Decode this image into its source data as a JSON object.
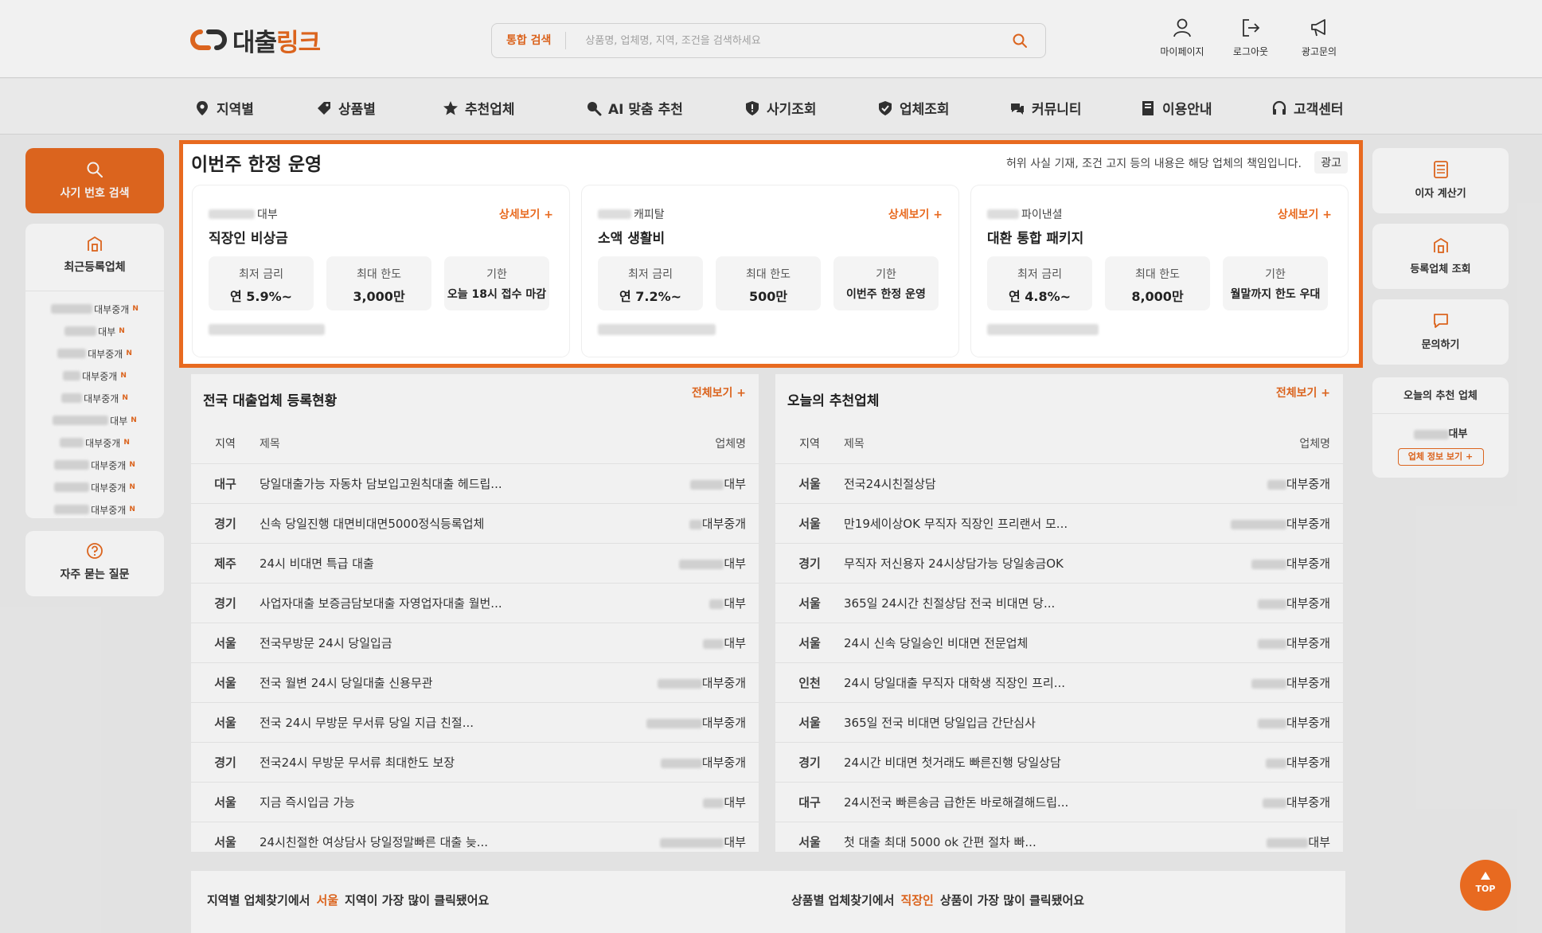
{
  "header": {
    "logo_text_a": "대출",
    "logo_text_b": "링크",
    "search_label": "통합 검색",
    "search_placeholder": "상품명, 업체명, 지역, 조건을 검색하세요",
    "icons": [
      {
        "label": "마이페이지",
        "icon": "user-icon"
      },
      {
        "label": "로그아웃",
        "icon": "logout-icon"
      },
      {
        "label": "광고문의",
        "icon": "megaphone-icon"
      }
    ]
  },
  "nav": [
    {
      "label": "지역별",
      "icon": "map-pin-icon"
    },
    {
      "label": "상품별",
      "icon": "tag-icon"
    },
    {
      "label": "추천업체",
      "icon": "star-icon"
    },
    {
      "label": "AI 맞춤 추천",
      "icon": "search-ai-icon"
    },
    {
      "label": "사기조회",
      "icon": "shield-alert-icon"
    },
    {
      "label": "업체조회",
      "icon": "shield-check-icon"
    },
    {
      "label": "커뮤니티",
      "icon": "chat-icon"
    },
    {
      "label": "이용안내",
      "icon": "book-icon"
    },
    {
      "label": "고객센터",
      "icon": "headset-icon"
    }
  ],
  "left_sidebar": {
    "fraud_search": "사기 번호 검색",
    "recent_title": "최근등록업체",
    "recent_items": [
      {
        "suffix": "대부중개",
        "new": "N"
      },
      {
        "suffix": "대부",
        "new": "N"
      },
      {
        "suffix": "대부중개",
        "new": "N"
      },
      {
        "suffix": "대부중개",
        "new": "N"
      },
      {
        "suffix": "대부중개",
        "new": "N"
      },
      {
        "suffix": "대부",
        "new": "N"
      },
      {
        "suffix": "대부중개",
        "new": "N"
      },
      {
        "suffix": "대부중개",
        "new": "N"
      },
      {
        "suffix": "대부중개",
        "new": "N"
      },
      {
        "suffix": "대부중개",
        "new": "N"
      }
    ],
    "faq": "자주 묻는 질문"
  },
  "featured": {
    "title": "이번주 한정 운영",
    "notice": "허위 사실 기재, 조건 고지 등의 내용은 해당 업체의 책임입니다.",
    "ad_label": "광고",
    "more_label": "상세보기 +",
    "cards": [
      {
        "company_suffix": "대부",
        "product": "직장인 비상금",
        "stats": [
          {
            "label": "최저 금리",
            "value": "연 5.9%~"
          },
          {
            "label": "최대 한도",
            "value": "3,000만"
          },
          {
            "label": "기한",
            "value": "오늘 18시 접수 마감"
          }
        ]
      },
      {
        "company_suffix": "캐피탈",
        "product": "소액 생활비",
        "stats": [
          {
            "label": "최저 금리",
            "value": "연 7.2%~"
          },
          {
            "label": "최대 한도",
            "value": "500만"
          },
          {
            "label": "기한",
            "value": "이번주 한정 운영"
          }
        ]
      },
      {
        "company_suffix": "파이낸셜",
        "product": "대환 통합 패키지",
        "stats": [
          {
            "label": "최저 금리",
            "value": "연 4.8%~"
          },
          {
            "label": "최대 한도",
            "value": "8,000만"
          },
          {
            "label": "기한",
            "value": "월말까지 한도 우대"
          }
        ]
      }
    ]
  },
  "registry": {
    "title": "전국 대출업체 등록현황",
    "more": "전체보기 +",
    "columns": [
      "지역",
      "제목",
      "업체명"
    ],
    "rows": [
      {
        "region": "대구",
        "title": "당일대출가능 자동차 담보입고원칙대출 헤드립...",
        "company": "대부"
      },
      {
        "region": "경기",
        "title": "신속 당일진행 대면비대면5000정식등록업체",
        "company": "대부중개"
      },
      {
        "region": "제주",
        "title": "24시 비대면 특급 대출",
        "company": "대부"
      },
      {
        "region": "경기",
        "title": "사업자대출 보증금담보대출 자영업자대출 월번...",
        "company": "대부"
      },
      {
        "region": "서울",
        "title": "전국무방문 24시 당일입금",
        "company": "대부"
      },
      {
        "region": "서울",
        "title": "전국 월변 24시 당일대출 신용무관",
        "company": "대부중개"
      },
      {
        "region": "서울",
        "title": "전국 24시 무방문 무서류 당일 지급 친절...",
        "company": "대부중개"
      },
      {
        "region": "경기",
        "title": "전국24시 무방문 무서류 최대한도 보장",
        "company": "대부중개"
      },
      {
        "region": "서울",
        "title": "지금 즉시입금 가능",
        "company": "대부"
      },
      {
        "region": "서울",
        "title": "24시친절한 여상담사 당일정말빠른 대출 늦...",
        "company": "대부"
      }
    ]
  },
  "recommended": {
    "title": "오늘의 추천업체",
    "more": "전체보기 +",
    "columns": [
      "지역",
      "제목",
      "업체명"
    ],
    "rows": [
      {
        "region": "서울",
        "title": "전국24시친절상담",
        "company": "대부중개"
      },
      {
        "region": "서울",
        "title": "만19세이상OK 무직자 직장인 프리랜서 모...",
        "company": "대부중개"
      },
      {
        "region": "경기",
        "title": "무직자 저신용자 24시상담가능 당일송금OK",
        "company": "대부중개"
      },
      {
        "region": "서울",
        "title": "365일 24시간 친절상담 전국 비대면 당...",
        "company": "대부중개"
      },
      {
        "region": "서울",
        "title": "24시 신속 당일승인 비대면 전문업체",
        "company": "대부중개"
      },
      {
        "region": "인천",
        "title": "24시 당일대출 무직자 대학생 직장인 프리...",
        "company": "대부중개"
      },
      {
        "region": "서울",
        "title": "365일 전국 비대면 당일입금 간단심사",
        "company": "대부중개"
      },
      {
        "region": "경기",
        "title": "24시간 비대면 첫거래도 빠른진행 당일상담",
        "company": "대부중개"
      },
      {
        "region": "대구",
        "title": "24시전국 빠른송금 급한돈 바로해결해드립...",
        "company": "대부중개"
      },
      {
        "region": "서울",
        "title": "첫 대출 최대 5000 ok 간편 절차 빠...",
        "company": "대부"
      }
    ]
  },
  "bottom": {
    "left_prefix": "지역별 업체찾기에서",
    "left_highlight": "서울",
    "left_suffix": "지역이 가장 많이 클릭됐어요",
    "right_prefix": "상품별 업체찾기에서",
    "right_highlight": "직장인",
    "right_suffix": "상품이 가장 많이 클릭됐어요"
  },
  "right_sidebar": {
    "items": [
      "이자 계산기",
      "등록업체 조회",
      "문의하기"
    ],
    "today_title": "오늘의 추천 업체",
    "today_company_suffix": "대부",
    "today_btn": "업체 정보 보기 +"
  },
  "top_button": "TOP",
  "colors": {
    "accent": "#e86a20"
  }
}
